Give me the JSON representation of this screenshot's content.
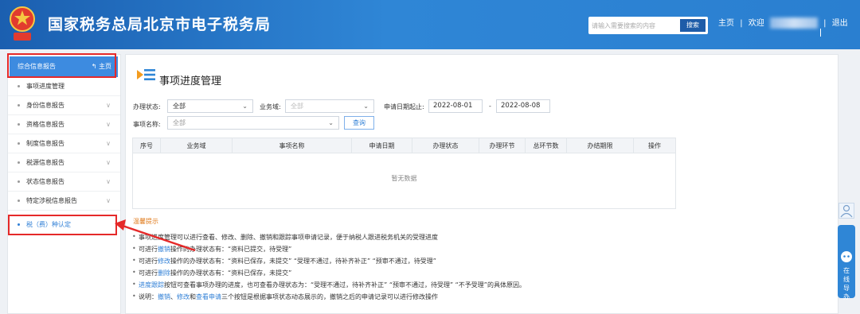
{
  "header": {
    "title": "国家税务总局北京市电子税务局",
    "search_placeholder": "请输入需要搜索的内容",
    "search_button": "搜索",
    "home_link": "主页",
    "welcome": "欢迎",
    "logout": "退出",
    "sep": "|"
  },
  "sidebar": {
    "head_label": "综合信息报告",
    "head_home": "主页",
    "items": [
      {
        "label": "事项进度管理"
      },
      {
        "label": "身份信息报告"
      },
      {
        "label": "资格信息报告"
      },
      {
        "label": "制度信息报告"
      },
      {
        "label": "税源信息报告"
      },
      {
        "label": "状态信息报告"
      },
      {
        "label": "特定涉税信息报告"
      },
      {
        "label": "税（费）种认定"
      }
    ]
  },
  "main": {
    "page_title": "事项进度管理",
    "filters": {
      "status_label": "办理状态:",
      "status_value": "全部",
      "domain_label": "业务域:",
      "domain_value": "全部",
      "date_label": "申请日期起止:",
      "date_from": "2022-08-01",
      "date_dash": "-",
      "date_to": "2022-08-08",
      "name_label": "事项名称:",
      "name_value": "全部",
      "query_button": "查询"
    },
    "table": {
      "columns": [
        "序号",
        "业务域",
        "事项名称",
        "申请日期",
        "办理状态",
        "办理环节",
        "总环节数",
        "办结期限",
        "操作"
      ],
      "empty_text": "暂无数据"
    },
    "tips": {
      "title": "温馨提示",
      "lines": [
        {
          "pre": "事项进度管理可以进行查看、修改、删除、撤销和跟踪事项申请记录，便于纳税人跟进税务机关的受理进度",
          "b1": "",
          "mid": "",
          "b2": "",
          "mid2": "",
          "b3": "",
          "post": ""
        },
        {
          "pre": "可进行",
          "b1": "撤销",
          "mid": "操作的办理状态有：“资料已提交，待受理”",
          "b2": "",
          "mid2": "",
          "b3": "",
          "post": ""
        },
        {
          "pre": "可进行",
          "b1": "修改",
          "mid": "操作的办理状态有：“资料已保存，未提交”  “受理不通过，待补齐补正”  “预审不通过，待受理”",
          "b2": "",
          "mid2": "",
          "b3": "",
          "post": ""
        },
        {
          "pre": "可进行",
          "b1": "删除",
          "mid": "操作的办理状态有：“资料已保存，未提交”",
          "b2": "",
          "mid2": "",
          "b3": "",
          "post": ""
        },
        {
          "pre": "",
          "b1": "进度跟踪",
          "mid": "按钮可查看事项办理的进度，也可查看办理状态为：“受理不通过，待补齐补正”  “预审不通过，待受理”  “不予受理”的具体原因。",
          "b2": "",
          "mid2": "",
          "b3": "",
          "post": ""
        },
        {
          "pre": "说明：",
          "b1": "撤销",
          "mid": "、",
          "b2": "修改",
          "mid2": "和",
          "b3": "查看申请",
          "post": "三个按钮是根据事项状态动态展示的，撤销之后的申请记录可以进行修改操作"
        }
      ]
    }
  },
  "float_widget": {
    "label": "在线导办"
  },
  "colors": {
    "header_blue": "#2f86d6",
    "accent_blue": "#2f7fd6",
    "annotation_red": "#e52929",
    "tip_orange": "#e07a1a"
  }
}
